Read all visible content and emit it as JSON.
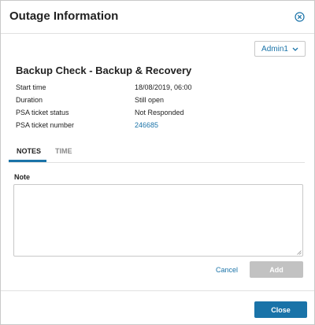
{
  "dialog": {
    "title": "Outage Information",
    "close_icon": "close-circle-icon"
  },
  "user_menu": {
    "label": "Admin1",
    "icon": "chevron-down-icon"
  },
  "outage": {
    "title": "Backup Check - Backup & Recovery",
    "fields": [
      {
        "key": "Start time",
        "value": "18/08/2019, 06:00"
      },
      {
        "key": "Duration",
        "value": "Still open"
      },
      {
        "key": "PSA ticket status",
        "value": "Not Responded"
      },
      {
        "key": "PSA ticket number",
        "value": "246685"
      }
    ]
  },
  "tabs": [
    {
      "label": "NOTES",
      "active": true
    },
    {
      "label": "TIME",
      "active": false
    }
  ],
  "note": {
    "label": "Note",
    "value": "",
    "placeholder": ""
  },
  "actions": {
    "cancel_label": "Cancel",
    "add_label": "Add"
  },
  "footer": {
    "close_label": "Close"
  },
  "colors": {
    "accent": "#1a73a8",
    "disabled": "#c2c2c2",
    "border": "#c8c8c8"
  }
}
